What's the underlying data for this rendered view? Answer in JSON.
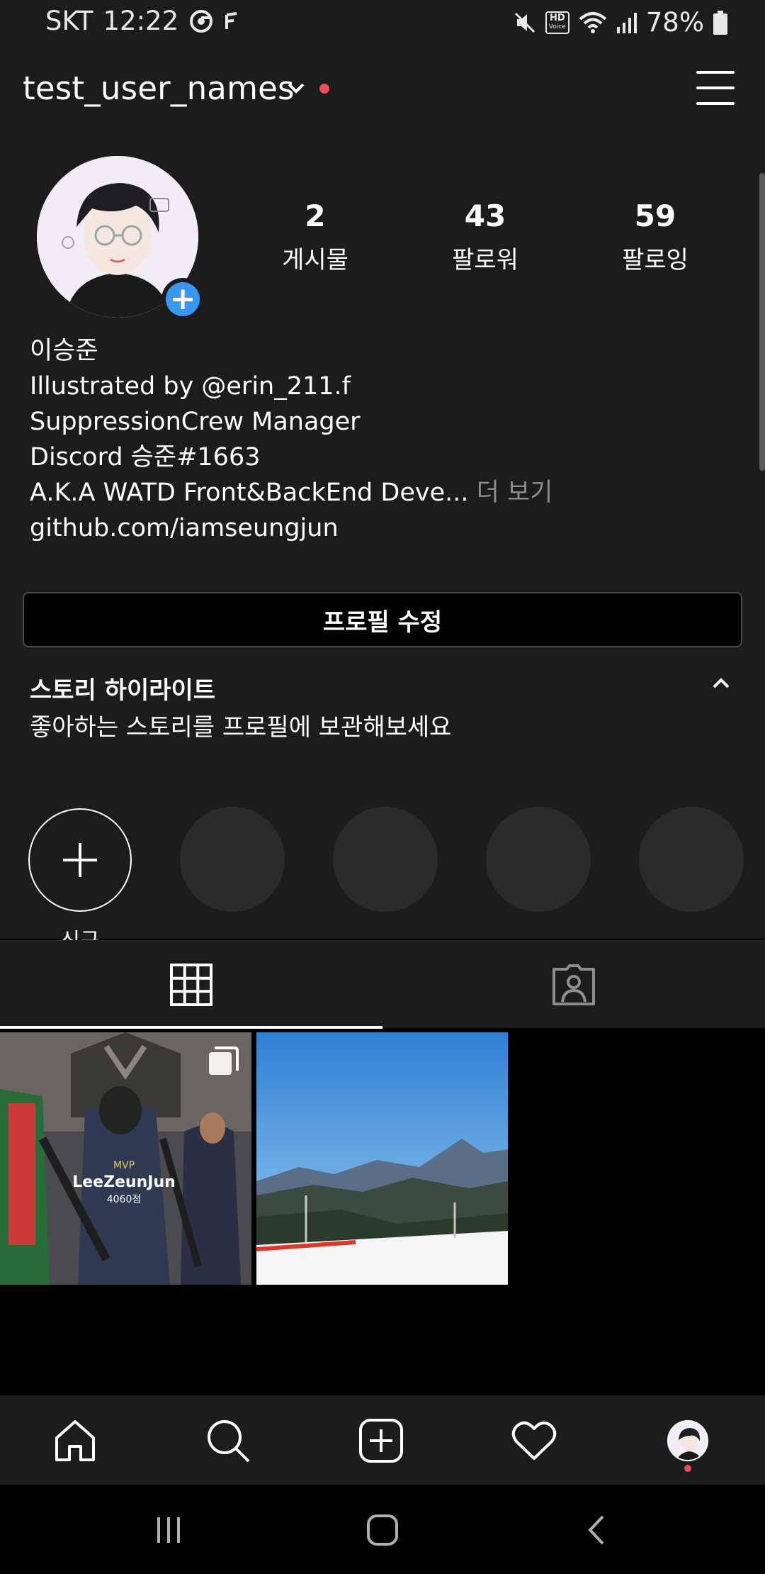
{
  "status_bar": {
    "carrier": "SKT",
    "time": "12:22",
    "hd_badge_top": "HD",
    "hd_badge_bottom": "Voice",
    "battery": "78%",
    "icons": [
      "chrome-icon",
      "app-f-icon",
      "mute-icon",
      "hd-voice-icon",
      "wifi-icon",
      "signal-icon",
      "battery-icon"
    ]
  },
  "header": {
    "username": "test_user_names",
    "menu_icon": "hamburger-icon"
  },
  "profile": {
    "stats": [
      {
        "value": "2",
        "label": "게시물"
      },
      {
        "value": "43",
        "label": "팔로워"
      },
      {
        "value": "59",
        "label": "팔로잉"
      }
    ],
    "bio": {
      "name": "이승준",
      "line1": "Illustrated by @erin_211.f",
      "line2": "SuppressionCrew Manager",
      "line3": "Discord 승준#1663",
      "line4": "A.K.A WATD Front&BackEnd Deve...",
      "more": " 더 보기",
      "link": "github.com/iamseungjun"
    },
    "edit_button": "프로필 수정"
  },
  "highlights": {
    "title": "스토리 하이라이트",
    "subtitle": "좋아하는 스토리를 프로필에 보관해보세요",
    "new_label": "신규",
    "placeholder_count": 4
  },
  "tabs": [
    {
      "name": "grid",
      "icon": "grid-icon",
      "active": true
    },
    {
      "name": "tagged",
      "icon": "tagged-icon",
      "active": false
    }
  ],
  "posts": [
    {
      "caption_mvp": "MVP",
      "caption_name": "LeeZeunJun",
      "caption_score": "4060점",
      "multi": true
    },
    {
      "scene": "mountain-ski-slope",
      "multi": false
    }
  ],
  "bottom_nav": [
    "home-icon",
    "search-icon",
    "new-post-icon",
    "activity-heart-icon",
    "profile-avatar"
  ],
  "system_nav": [
    "recent-apps-icon",
    "home-button-icon",
    "back-icon"
  ],
  "colors": {
    "background": "#1c1c1c",
    "accent_blue": "#3897f0",
    "notification_red": "#ed4956",
    "muted_text": "#8e8e8e"
  }
}
